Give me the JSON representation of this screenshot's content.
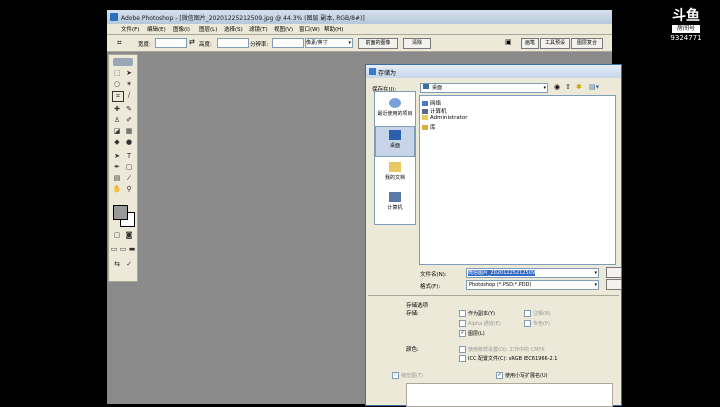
{
  "window": {
    "title": "Adobe Photoshop - [微信图片_20201225212509.jpg @ 44.3% (图层 副本, RGB/8#)]"
  },
  "menu": [
    "文件(F)",
    "编辑(E)",
    "图像(I)",
    "图层(L)",
    "选择(S)",
    "滤镜(T)",
    "视图(V)",
    "窗口(W)",
    "帮助(H)"
  ],
  "options": {
    "width_label": "宽度:",
    "height_label": "高度:",
    "resolution_label": "分辨率:",
    "unit": "像素/英寸",
    "front_image_btn": "前面的图像",
    "clear_btn": "清除"
  },
  "panel_tabs": [
    "画笔",
    "工具预设",
    "图层复合"
  ],
  "dialog": {
    "title": "存储为",
    "save_in_label": "保存在(I):",
    "save_in_value": "桌面",
    "places": [
      "最近使用的项目",
      "桌面",
      "我的文档",
      "计算机"
    ],
    "files": [
      "网络",
      "计算机",
      "Administrator",
      "库"
    ],
    "filename_label": "文件名(N):",
    "filename_value": "微信图片_20201225212509",
    "format_label": "格式(F):",
    "format_value": "Photoshop (*.PSD;*.PDD)",
    "save_options_label": "存储选项",
    "save_label": "存储:",
    "as_copy": "作为副本(Y)",
    "notes": "注释(N)",
    "alpha": "Alpha 通道(E)",
    "spot": "专色(P)",
    "layers": "图层(L)",
    "color_label": "颜色:",
    "use_proof": "使用校样设置(O): 工作中的 CMYK",
    "icc": "ICC 配置文件(C): sRGB IEC61966-2.1",
    "thumbnail": "缩览图(T)",
    "lowercase_ext": "使用小写扩展名(U)"
  },
  "logo": {
    "text": "斗鱼",
    "sub": "房间号",
    "room": "9324771"
  }
}
